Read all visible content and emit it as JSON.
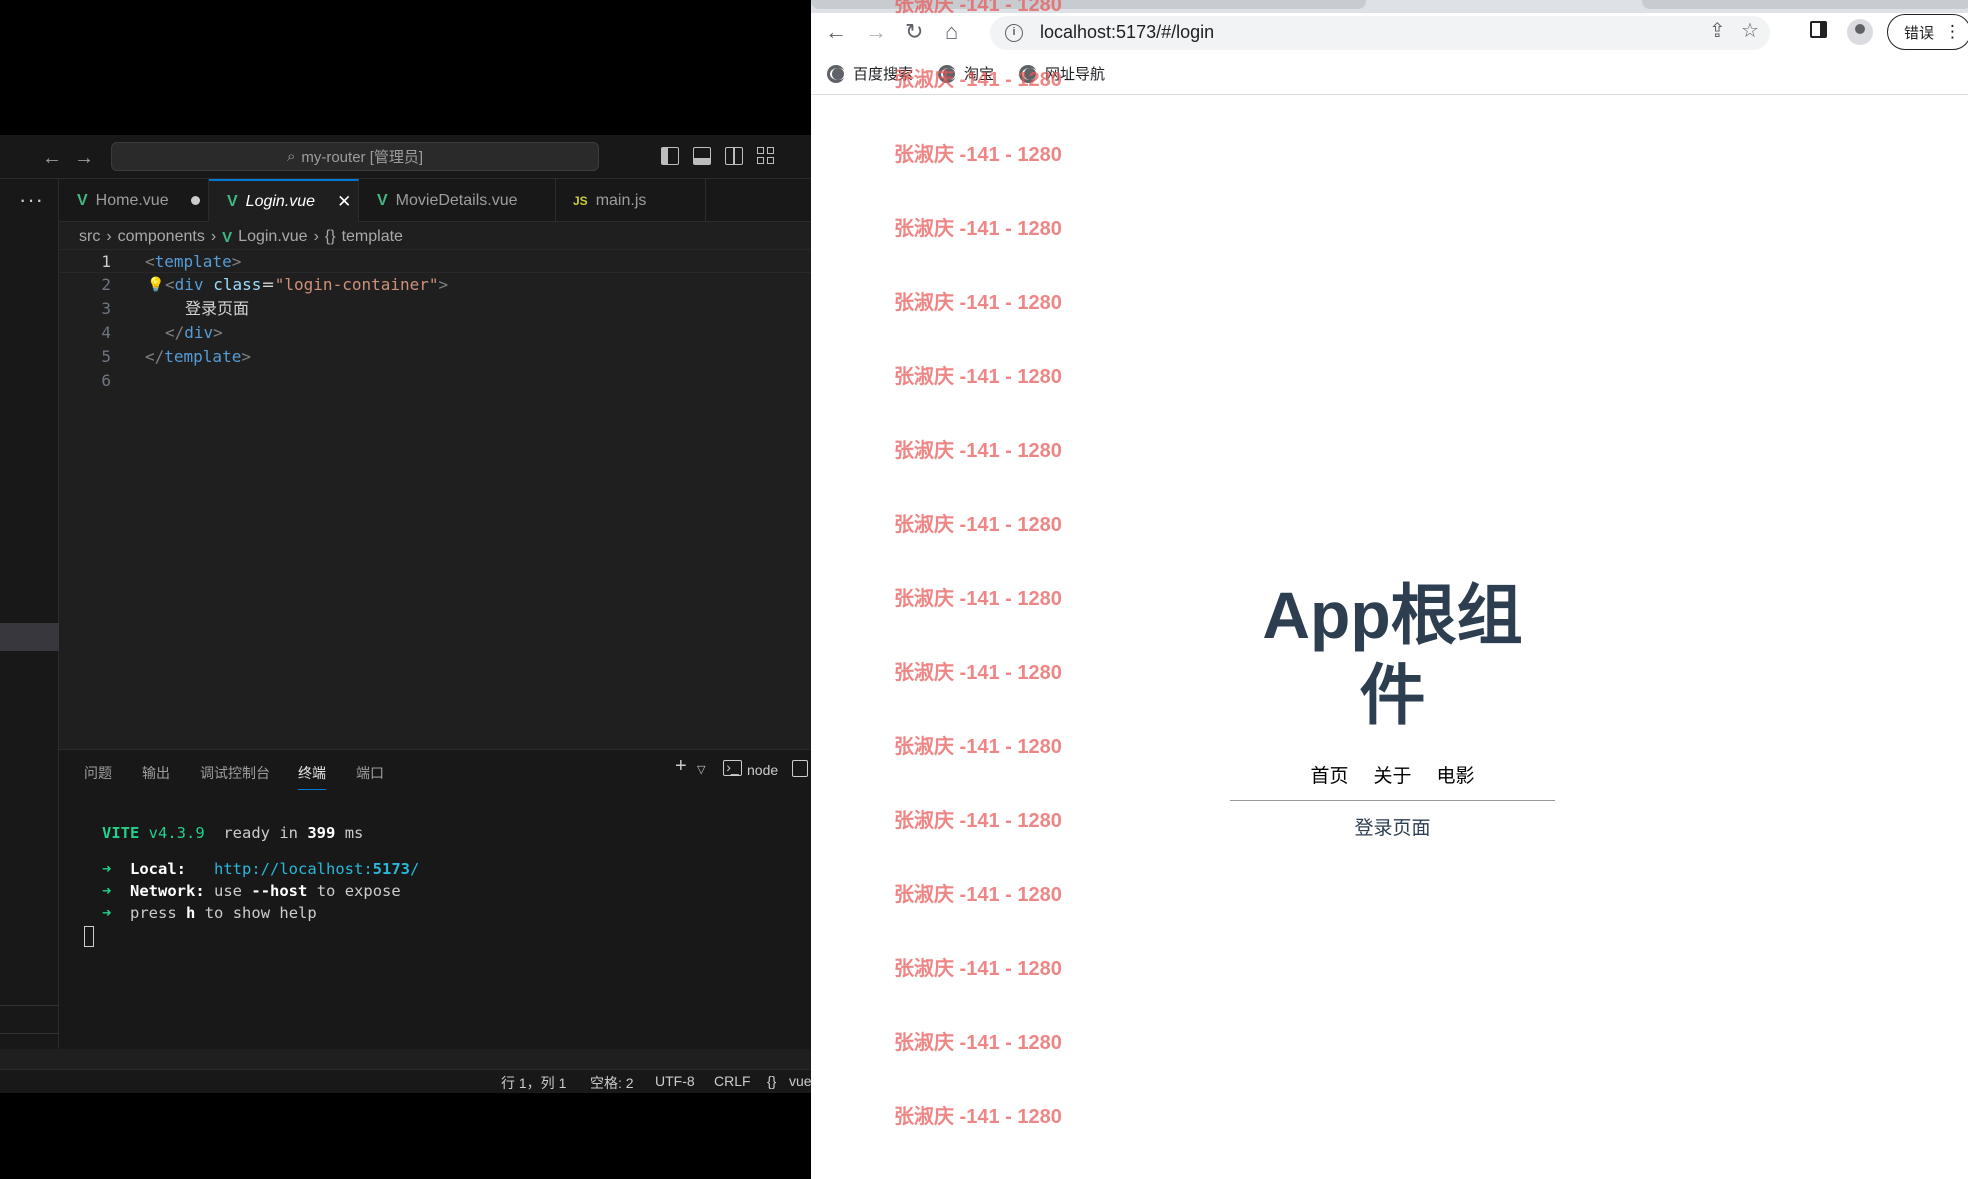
{
  "vscode": {
    "search_text": "my-router [管理员]",
    "tabs": [
      {
        "label": "Home.vue",
        "icon": "vue-icon"
      },
      {
        "label": "Login.vue",
        "icon": "vue-icon"
      },
      {
        "label": "MovieDetails.vue",
        "icon": "vue-icon"
      },
      {
        "label": "main.js",
        "icon": "js-icon"
      }
    ],
    "breadcrumb": [
      "src",
      "components",
      "Login.vue",
      "template"
    ],
    "line_numbers": [
      "1",
      "2",
      "3",
      "4",
      "5",
      "6"
    ],
    "code": {
      "l1_tag": "template",
      "l2_tag": "div",
      "l2_attr": "class",
      "l2_value": "\"login-container\"",
      "l3_text": "登录页面",
      "l4_tag": "div",
      "l5_tag": "template"
    },
    "panel_tabs": [
      "问题",
      "输出",
      "调试控制台",
      "终端",
      "端口"
    ],
    "panel_terminal_name": "node",
    "terminal": {
      "vite": "VITE",
      "version": "v4.3.9",
      "ready": "ready in",
      "ms_value": "399",
      "ms": "ms",
      "arrow": "➜",
      "local_label": "Local:",
      "local_url_prefix": "http://localhost:",
      "local_port": "5173",
      "local_slash": "/",
      "network_label": "Network:",
      "network_use": "use",
      "network_flag": "--host",
      "network_rest": "to expose",
      "press": "press",
      "key": "h",
      "help": "to show help"
    },
    "status": {
      "position": "行 1，列 1",
      "spaces": "空格: 2",
      "encoding": "UTF-8",
      "eol": "CRLF",
      "language": "vue"
    }
  },
  "browser": {
    "url": "localhost:5173/#/login",
    "error_button": "错误",
    "bookmarks": [
      "百度搜索",
      "淘宝",
      "网址导航"
    ],
    "watermark": "张淑庆 -141 - 1280",
    "app": {
      "title": "App根组件",
      "nav": [
        "首页",
        "关于",
        "电影"
      ],
      "view_text": "登录页面"
    }
  },
  "colors": {
    "editor_bg": "#1f1f1f",
    "accent": "#0078d4",
    "vue_green": "#41b883",
    "app_title": "#2c3e50",
    "watermark": "#e85858"
  }
}
